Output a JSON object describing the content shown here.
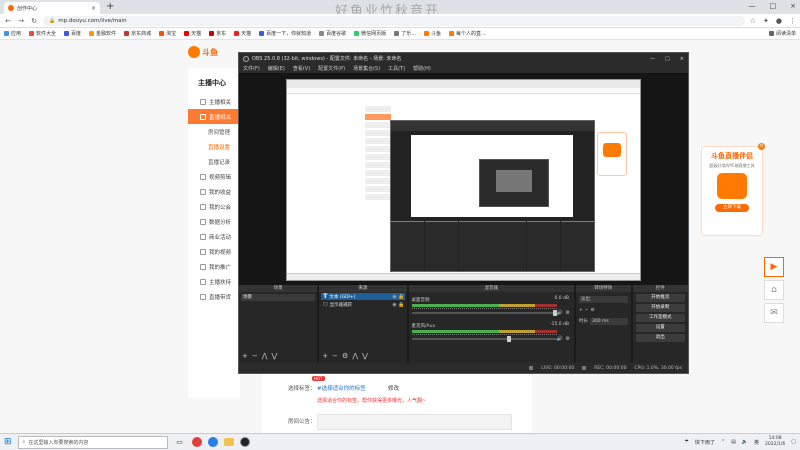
{
  "browser": {
    "tab_title": "创作中心",
    "tab_close": "×",
    "new_tab": "+",
    "watermark": "好鱼业竹秋音开",
    "url": "mp.douyu.com/live/main",
    "bookmarks": [
      "应用",
      "软件大全",
      "百度",
      "金融软件",
      "京东商城",
      "淘宝",
      "天猫",
      "京东",
      "天猫",
      "百度一下，你就知道",
      "百度谷歌",
      "微信网页版",
      "了乐...",
      "斗鱼",
      "每个人的直..."
    ],
    "bookmarks_right": "阅读清单",
    "win_controls": [
      "—",
      "□",
      "×"
    ]
  },
  "site": {
    "logo_text": "斗鱼",
    "sidenav": {
      "header": "主播中心",
      "items": [
        {
          "label": "主播相关",
          "type": "normal"
        },
        {
          "label": "直播相关",
          "type": "active"
        },
        {
          "label": "房间管理",
          "type": "sub-plain"
        },
        {
          "label": "直播设置",
          "type": "sub"
        },
        {
          "label": "直播记录",
          "type": "sub-plain"
        },
        {
          "label": "视频剪辑",
          "type": "normal"
        },
        {
          "label": "我的收益",
          "type": "normal"
        },
        {
          "label": "我的公会",
          "type": "normal"
        },
        {
          "label": "数据分析",
          "type": "normal"
        },
        {
          "label": "商业活动",
          "type": "normal"
        },
        {
          "label": "我的视频",
          "type": "normal"
        },
        {
          "label": "我的推广",
          "type": "normal"
        },
        {
          "label": "主播扶持",
          "type": "normal"
        },
        {
          "label": "直播带货",
          "type": "normal"
        }
      ]
    },
    "form": {
      "hot_badge": "HOT",
      "label_title": "选择标签：",
      "tag_link": "#选择适合你的标签",
      "edit": "修改",
      "hint": "选择适合你的标签，帮你获得更多曝光，人气翻~",
      "label_notice": "房间公告："
    },
    "ad": {
      "title": "斗鱼直播伴侣",
      "sub": "超级好用的PC端直播工具",
      "button": "立即下载",
      "close": "×"
    }
  },
  "obs": {
    "title": "OBS 25.0.8 (32-bit, windows) - 配置文件: 未命名 - 场景: 未命名",
    "menu": [
      "文件(F)",
      "编辑(E)",
      "查看(V)",
      "配置文件(P)",
      "场景集合(S)",
      "工具(T)",
      "帮助(H)"
    ],
    "docks": {
      "scenes": {
        "title": "场景",
        "items": [
          "场景"
        ]
      },
      "sources": {
        "title": "来源",
        "items": [
          {
            "label": "文本 (GDI+)",
            "icon": "T",
            "selected": true
          },
          {
            "label": "显示器捕获",
            "icon": "□",
            "selected": false
          }
        ]
      },
      "mixer": {
        "title": "混音器",
        "channels": [
          {
            "name": "桌面音频",
            "db": "0.0 dB",
            "level": 0.0
          },
          {
            "name": "麦克风/Aux",
            "db": "-15.0 dB",
            "level": 0.45
          }
        ]
      },
      "transitions": {
        "title": "转场特效",
        "type": "淡出",
        "duration_label": "时长",
        "duration": "300 ms"
      },
      "controls": {
        "title": "控件",
        "buttons": [
          "开始推流",
          "开始录制",
          "工作室模式",
          "设置",
          "退出"
        ]
      }
    },
    "status": {
      "live": "LIVE: 00:00:00",
      "rec": "REC: 00:00:00",
      "cpu": "CPU: 1.0%, 30.00 fps"
    }
  },
  "taskbar": {
    "search_placeholder": "在这里输入你要搜索的内容",
    "apps": [
      "任务视图",
      "Chrome",
      "浏览器",
      "资源管理器",
      "OBS"
    ],
    "tray_text": "快下雨了",
    "ime": "英",
    "time": "14:08",
    "date": "2022/1/6"
  }
}
